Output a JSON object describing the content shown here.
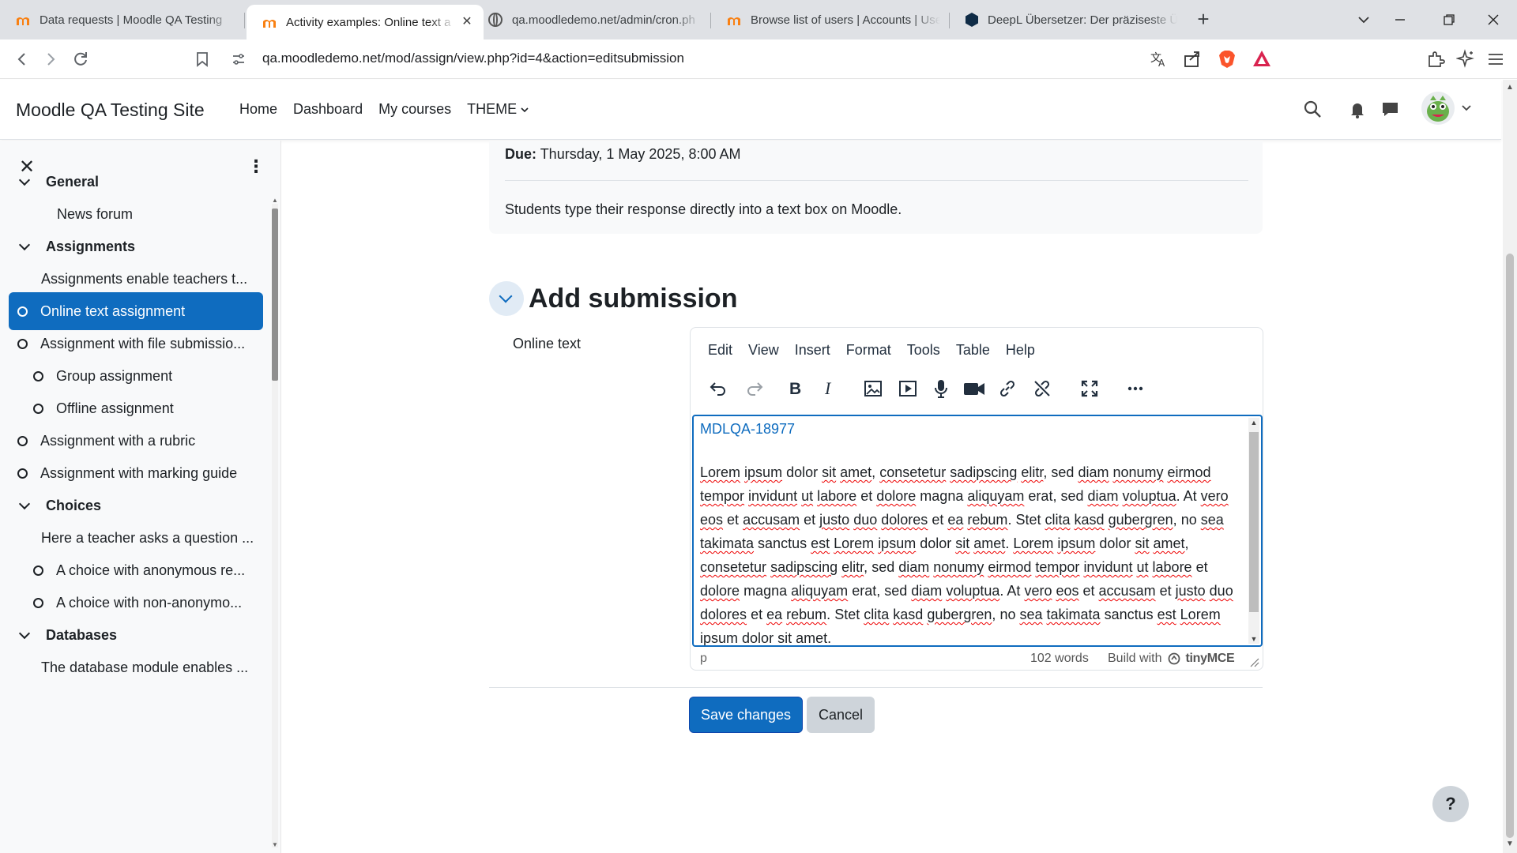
{
  "browser": {
    "tabs": [
      {
        "label": "Data requests | Moodle QA Testing",
        "icon": "moodle-icon",
        "active": false
      },
      {
        "label": "Activity examples: Online text a",
        "icon": "moodle-icon",
        "active": true
      },
      {
        "label": "qa.moodledemo.net/admin/cron.ph",
        "icon": "globe-icon",
        "active": false
      },
      {
        "label": "Browse list of users | Accounts | Use",
        "icon": "moodle-icon",
        "active": false
      },
      {
        "label": "DeepL Übersetzer: Der präziseste Üb",
        "icon": "deepl-icon",
        "active": false
      }
    ],
    "close_glyph": "✕",
    "new_tab_glyph": "+",
    "url": "qa.moodledemo.net/mod/assign/view.php?id=4&action=editsubmission"
  },
  "navbar": {
    "site_name": "Moodle QA Testing Site",
    "links": [
      "Home",
      "Dashboard",
      "My courses",
      "THEME"
    ]
  },
  "drawer": {
    "close_glyph": "✕",
    "more_glyph": "⋮",
    "items": [
      {
        "type": "section",
        "label": "General"
      },
      {
        "type": "activity",
        "label": "News forum",
        "indent": 2,
        "marker": false
      },
      {
        "type": "section",
        "label": "Assignments"
      },
      {
        "type": "activity",
        "label": "Assignments enable teachers t...",
        "indent": 1,
        "marker": false
      },
      {
        "type": "activity",
        "label": "Online text assignment",
        "indent": 1,
        "marker": true,
        "active": true
      },
      {
        "type": "activity",
        "label": "Assignment with file submissio...",
        "indent": 1,
        "marker": true
      },
      {
        "type": "activity",
        "label": "Group assignment",
        "indent": 2,
        "marker": true
      },
      {
        "type": "activity",
        "label": "Offline assignment",
        "indent": 2,
        "marker": true
      },
      {
        "type": "activity",
        "label": "Assignment with a rubric",
        "indent": 1,
        "marker": true
      },
      {
        "type": "activity",
        "label": "Assignment with marking guide",
        "indent": 1,
        "marker": true
      },
      {
        "type": "section",
        "label": "Choices"
      },
      {
        "type": "activity",
        "label": "Here a teacher asks a question ...",
        "indent": 1,
        "marker": false
      },
      {
        "type": "activity",
        "label": "A choice with anonymous re...",
        "indent": 2,
        "marker": true
      },
      {
        "type": "activity",
        "label": "A choice with non-anonymo...",
        "indent": 2,
        "marker": true
      },
      {
        "type": "section",
        "label": "Databases"
      },
      {
        "type": "activity",
        "label": "The database module enables ...",
        "indent": 1,
        "marker": false
      }
    ]
  },
  "assignment": {
    "due_label": "Due:",
    "due_value": "Thursday, 1 May 2025, 8:00 AM",
    "description": "Students type their response directly into a text box on Moodle."
  },
  "submission": {
    "title": "Add submission",
    "field_label": "Online text",
    "editor": {
      "menus": [
        "Edit",
        "View",
        "Insert",
        "Format",
        "Tools",
        "Table",
        "Help"
      ],
      "toolbar": [
        "undo-icon",
        "redo-icon",
        "bold-icon",
        "italic-icon",
        "image-icon",
        "media-icon",
        "microphone-icon",
        "video-camera-icon",
        "link-icon",
        "unlink-icon",
        "fullscreen-icon",
        "more-icon"
      ],
      "link_text": "MDLQA-18977",
      "body": "Lorem ipsum dolor sit amet, consetetur sadipscing elitr, sed diam nonumy eirmod tempor invidunt ut labore et dolore magna aliquyam erat, sed diam voluptua. At vero eos et accusam et justo duo dolores et ea rebum. Stet clita kasd gubergren, no sea takimata sanctus est Lorem ipsum dolor sit amet. Lorem ipsum dolor sit amet, consetetur sadipscing elitr, sed diam nonumy eirmod tempor invidunt ut labore et dolore magna aliquyam erat, sed diam voluptua. At vero eos et accusam et justo duo dolores et ea rebum. Stet clita kasd gubergren, no sea takimata sanctus est Lorem ipsum dolor sit amet.",
      "misspelled": [
        "Lorem",
        "ipsum",
        "sit",
        "amet",
        "consetetur",
        "sadipscing",
        "elitr",
        "diam",
        "nonumy",
        "eirmod",
        "tempor",
        "invidunt",
        "ut",
        "labore",
        "dolore",
        "aliquyam",
        "voluptua",
        "vero",
        "eos",
        "accusam",
        "justo",
        "duo",
        "dolores",
        "ea",
        "rebum",
        "clita",
        "kasd",
        "gubergren",
        "sea",
        "takimata",
        "est"
      ],
      "status_path": "p",
      "word_count": "102 words",
      "brand_prefix": "Build with",
      "brand_name": "tinyMCE"
    },
    "save_label": "Save changes",
    "cancel_label": "Cancel"
  },
  "help_label": "?",
  "colors": {
    "primary": "#0f6cbf",
    "active_item": "#0f6cbf",
    "spell_error": "#e00000"
  }
}
